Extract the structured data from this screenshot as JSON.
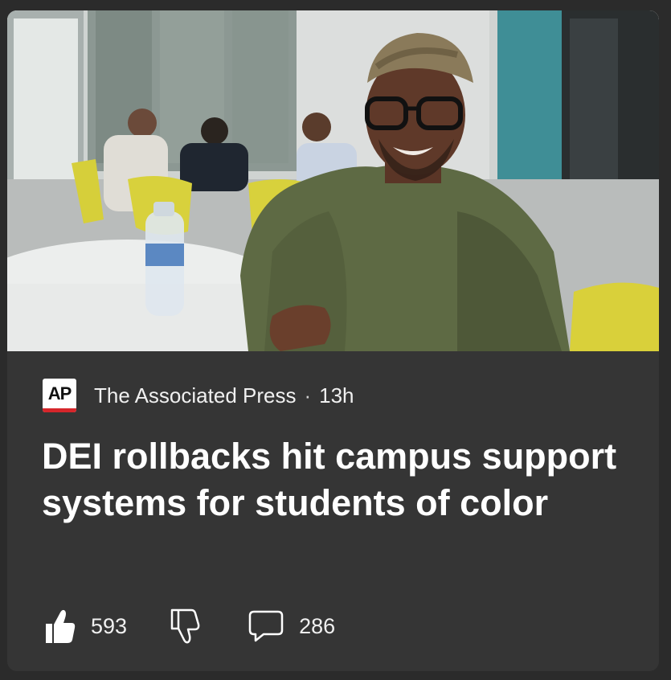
{
  "article": {
    "source": "The Associated Press",
    "source_logo_text": "AP",
    "age": "13h",
    "headline": "DEI rollbacks hit campus support systems for students of color"
  },
  "actions": {
    "like_count": "593",
    "comment_count": "286"
  },
  "icons": {
    "like": "thumbs-up-icon",
    "dislike": "thumbs-down-icon",
    "comment": "comment-icon"
  },
  "colors": {
    "card_background": "#353535",
    "page_background": "#2b2b2b",
    "logo_accent": "#d6262b",
    "text": "#ffffff"
  }
}
